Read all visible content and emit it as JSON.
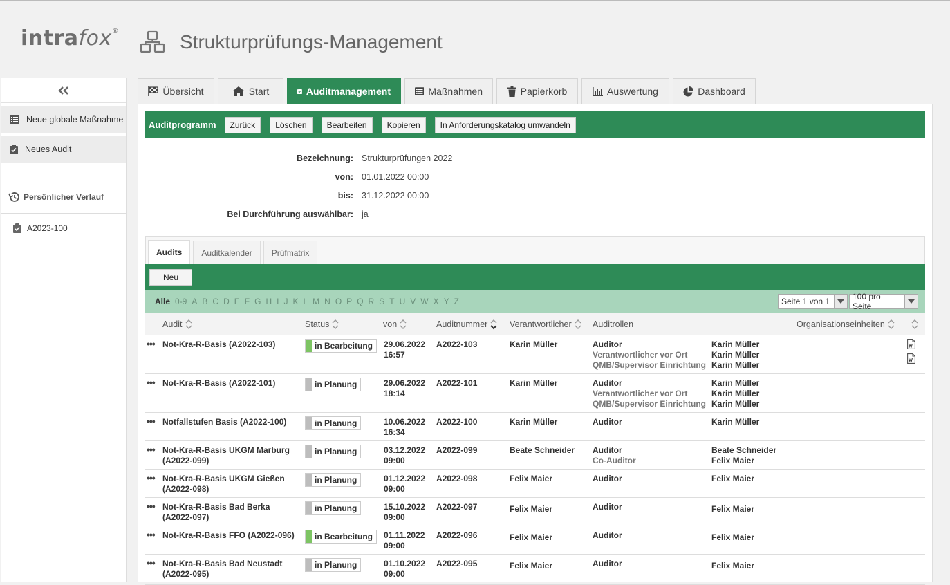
{
  "app": {
    "logo_a": "intra",
    "logo_b": "fox",
    "logo_mark": "®",
    "title": "Strukturprüfungs-Management"
  },
  "sidebar": {
    "collapse_icon": "double-chevron-left-icon",
    "items": [
      {
        "label": "Neue globale Maßnahme",
        "icon": "list-icon"
      },
      {
        "label": "Neues Audit",
        "icon": "clipboard-check-icon"
      }
    ],
    "history_title": "Persönlicher Verlauf",
    "history_items": [
      {
        "label": "A2023-100"
      }
    ]
  },
  "tabs": [
    {
      "label": "Übersicht",
      "icon": "flag-icon"
    },
    {
      "label": "Start",
      "icon": "home-icon"
    },
    {
      "label": "Auditmanagement",
      "icon": "clipboard-check-icon",
      "active": true
    },
    {
      "label": "Maßnahmen",
      "icon": "list-icon"
    },
    {
      "label": "Papierkorb",
      "icon": "trash-icon"
    },
    {
      "label": "Auswertung",
      "icon": "bar-chart-icon"
    },
    {
      "label": "Dashboard",
      "icon": "pie-chart-icon"
    }
  ],
  "toolbar": {
    "title": "Auditprogramm",
    "buttons": [
      "Zurück",
      "Löschen",
      "Bearbeiten",
      "Kopieren",
      "In Anforderungskatalog umwandeln"
    ]
  },
  "fields": [
    {
      "label": "Bezeichnung:",
      "value": "Strukturprüfungen 2022"
    },
    {
      "label": "von:",
      "value": "01.01.2022 00:00"
    },
    {
      "label": "bis:",
      "value": "31.12.2022 00:00"
    },
    {
      "label": "Bei Durchführung auswählbar:",
      "value": "ja"
    }
  ],
  "subtabs": [
    {
      "label": "Audits",
      "active": true
    },
    {
      "label": "Auditkalender"
    },
    {
      "label": "Prüfmatrix"
    }
  ],
  "neu_label": "Neu",
  "alphabet": [
    "Alle",
    "0-9",
    "A",
    "B",
    "C",
    "D",
    "E",
    "F",
    "G",
    "H",
    "I",
    "J",
    "K",
    "L",
    "M",
    "N",
    "O",
    "P",
    "Q",
    "R",
    "S",
    "T",
    "U",
    "V",
    "W",
    "X",
    "Y",
    "Z"
  ],
  "pager": {
    "page": "Seite 1 von 1",
    "per_page": "100 pro Seite"
  },
  "columns": {
    "audit": "Audit",
    "status": "Status",
    "von": "von",
    "auditnummer": "Auditnummer",
    "verantwortlicher": "Verantwortlicher",
    "auditrollen": "Auditrollen",
    "org": "Organisationseinheiten"
  },
  "colors": {
    "accent": "#2e8b57",
    "alphabar": "#a8d5bb",
    "status_bearbeitung": "#7dc463",
    "status_planung": "#bdbdbd"
  },
  "rows": [
    {
      "audit1": "Not-Kra-R-Basis (A2022-103)",
      "audit2": "",
      "status": "in Bearbeitung",
      "status_type": "bearbeitung",
      "date": "29.06.2022",
      "time": "16:57",
      "nr": "A2022-103",
      "verantw": "Karin Müller",
      "roles": [
        "Auditor",
        "Verantwortlicher vor Ort",
        "QMB/Supervisor Einrichtung"
      ],
      "persons": [
        "Karin Müller",
        "Karin Müller",
        "Karin Müller"
      ],
      "docs": 2
    },
    {
      "audit1": "Not-Kra-R-Basis (A2022-101)",
      "audit2": "",
      "status": "in Planung",
      "status_type": "planung",
      "date": "29.06.2022",
      "time": "18:14",
      "nr": "A2022-101",
      "verantw": "Karin Müller",
      "roles": [
        "Auditor",
        "Verantwortlicher vor Ort",
        "QMB/Supervisor Einrichtung"
      ],
      "persons": [
        "Karin Müller",
        "Karin Müller",
        "Karin Müller"
      ],
      "docs": 0
    },
    {
      "audit1": "Notfallstufen Basis (A2022-100)",
      "audit2": "",
      "status": "in Planung",
      "status_type": "planung",
      "date": "10.06.2022",
      "time": "16:34",
      "nr": "A2022-100",
      "verantw": "Karin Müller",
      "roles": [
        "Auditor"
      ],
      "persons": [
        "Karin Müller"
      ],
      "docs": 0
    },
    {
      "audit1": "Not-Kra-R-Basis UKGM Marburg",
      "audit2": "(A2022-099)",
      "status": "in Planung",
      "status_type": "planung",
      "date": "03.12.2022",
      "time": "09:00",
      "nr": "A2022-099",
      "verantw": "Beate Schneider",
      "roles": [
        "Auditor",
        "Co-Auditor"
      ],
      "persons": [
        "Beate Schneider",
        "Felix Maier"
      ],
      "docs": 0
    },
    {
      "audit1": "Not-Kra-R-Basis UKGM Gießen",
      "audit2": "(A2022-098)",
      "status": "in Planung",
      "status_type": "planung",
      "date": "01.12.2022",
      "time": "09:00",
      "nr": "A2022-098",
      "verantw": "Felix Maier",
      "roles": [
        "Auditor"
      ],
      "persons": [
        "Felix Maier"
      ],
      "docs": 0
    },
    {
      "audit1": "Not-Kra-R-Basis Bad Berka",
      "audit2": "(A2022-097)",
      "status": "in Planung",
      "status_type": "planung",
      "date": "15.10.2022",
      "time": "09:00",
      "nr": "A2022-097",
      "verantw": "Felix Maier",
      "roles": [
        "Auditor"
      ],
      "persons": [
        "Felix Maier"
      ],
      "docs": 0
    },
    {
      "audit1": "Not-Kra-R-Basis FFO (A2022-096)",
      "audit2": "",
      "status": "in Bearbeitung",
      "status_type": "bearbeitung",
      "date": "01.11.2022",
      "time": "09:00",
      "nr": "A2022-096",
      "verantw": "Felix Maier",
      "roles": [
        "Auditor"
      ],
      "persons": [
        "Felix Maier"
      ],
      "docs": 0
    },
    {
      "audit1": "Not-Kra-R-Basis Bad Neustadt",
      "audit2": "(A2022-095)",
      "status": "in Planung",
      "status_type": "planung",
      "date": "01.10.2022",
      "time": "09:00",
      "nr": "A2022-095",
      "verantw": "Felix Maier",
      "roles": [
        "Auditor"
      ],
      "persons": [
        "Felix Maier"
      ],
      "docs": 0
    }
  ]
}
